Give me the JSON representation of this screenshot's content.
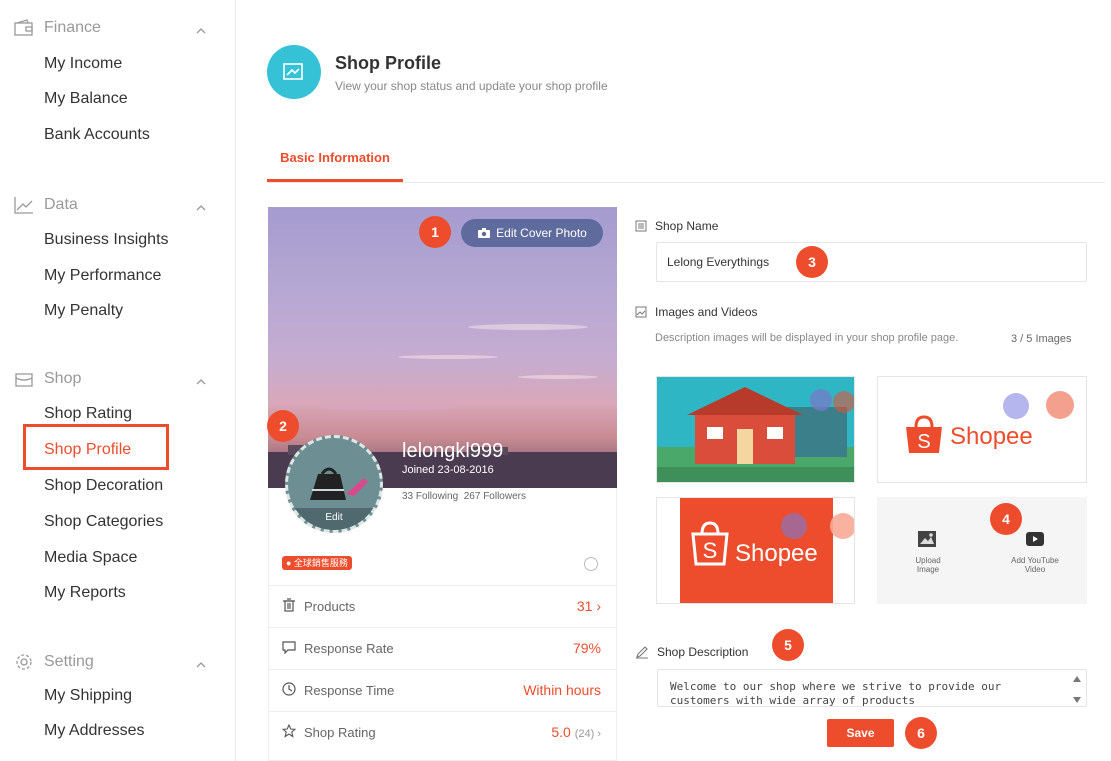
{
  "sidebar": {
    "sections": [
      {
        "title": "Finance",
        "items": [
          "My Income",
          "My Balance",
          "Bank Accounts"
        ]
      },
      {
        "title": "Data",
        "items": [
          "Business Insights",
          "My Performance",
          "My Penalty"
        ]
      },
      {
        "title": "Shop",
        "items": [
          "Shop Rating",
          "Shop Profile",
          "Shop Decoration",
          "Shop Categories",
          "Media Space",
          "My Reports"
        ]
      },
      {
        "title": "Setting",
        "items": [
          "My Shipping",
          "My Addresses"
        ]
      }
    ],
    "active_item": "Shop Profile"
  },
  "header": {
    "title": "Shop Profile",
    "subtitle": "View your shop status and update your shop profile"
  },
  "tabs": [
    {
      "label": "Basic Information"
    }
  ],
  "profile_card": {
    "edit_cover_label": "Edit Cover Photo",
    "username": "lelongkl999",
    "joined": "Joined 23-08-2016",
    "following_count": "33",
    "following_label": "Following",
    "followers_count": "267",
    "followers_label": "Followers",
    "avatar_edit_label": "Edit",
    "badge": "● 全球銷售服務",
    "stats": [
      {
        "label": "Products",
        "value": "31 ›",
        "extra": ""
      },
      {
        "label": "Response Rate",
        "value": "79%",
        "extra": ""
      },
      {
        "label": "Response Time",
        "value": "Within hours",
        "extra": ""
      },
      {
        "label": "Shop Rating",
        "value": "5.0",
        "extra": "(24) ›"
      }
    ]
  },
  "form": {
    "shop_name_label": "Shop Name",
    "shop_name_value": "Lelong Everythings",
    "images_label": "Images and Videos",
    "images_desc": "Description images will be displayed in your shop profile page.",
    "images_count": "3 / 5 Images",
    "tiles": [
      {
        "name": "school-image",
        "text": ""
      },
      {
        "name": "shopee-logo-white",
        "text": "Shopee"
      },
      {
        "name": "shopee-logo-orange",
        "text": "Shopee"
      }
    ],
    "upload_image_label": "Upload Image",
    "add_youtube_label": "Add YouTube Video",
    "description_label": "Shop Description",
    "description_value": "Welcome to our shop where we strive to provide our customers with wide array of products",
    "save_label": "Save"
  },
  "markers": [
    "1",
    "2",
    "3",
    "4",
    "5",
    "6"
  ],
  "colors": {
    "accent": "#ee4d2d",
    "header_icon": "#35c2d7"
  }
}
